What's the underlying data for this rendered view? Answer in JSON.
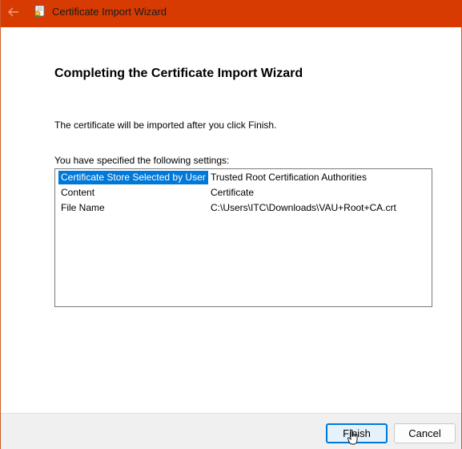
{
  "window": {
    "title": "Certificate Import Wizard",
    "titlebar_color": "#d83b01"
  },
  "icons": {
    "back": "back-arrow-icon",
    "app": "certificate-icon",
    "cursor": "mouse-pointer-icon"
  },
  "main": {
    "heading": "Completing the Certificate Import Wizard",
    "info": "The certificate will be imported after you click Finish.",
    "settings_label": "You have specified the following settings:",
    "settings": [
      {
        "key": "Certificate Store Selected by User",
        "value": "Trusted Root Certification Authorities",
        "selected": true
      },
      {
        "key": "Content",
        "value": "Certificate",
        "selected": false
      },
      {
        "key": "File Name",
        "value": "C:\\Users\\ITC\\Downloads\\VAU+Root+CA.crt",
        "selected": false
      }
    ]
  },
  "footer": {
    "finish_label": "Finish",
    "cancel_label": "Cancel"
  },
  "colors": {
    "accent": "#0078d7",
    "selection": "#0078d7"
  }
}
